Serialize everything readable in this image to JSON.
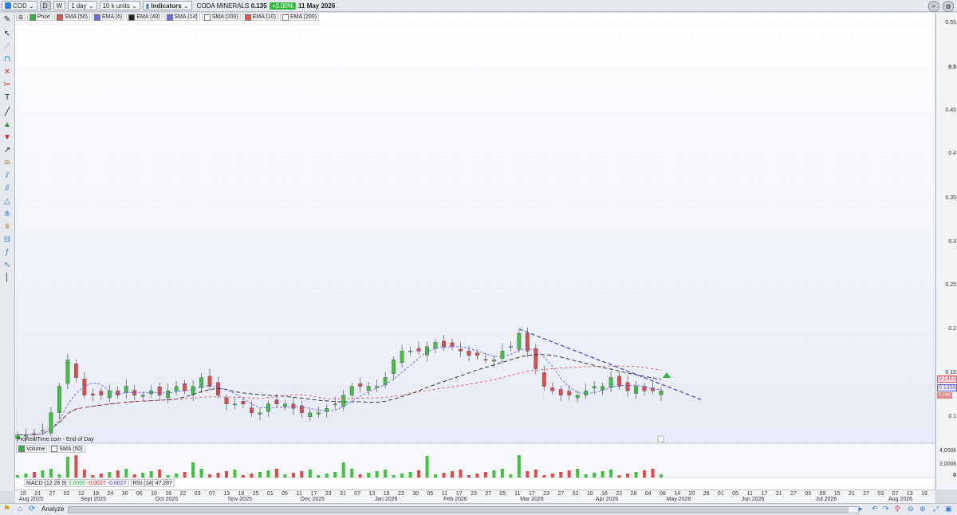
{
  "toolbar": {
    "symbol": "COD",
    "period_d": "D",
    "period_w": "W",
    "interval": "1 day",
    "units": "10 k units",
    "indicators_label": "Indicators",
    "instrument_name": "CODA MINERALS",
    "last_price": "0.135",
    "change": "+0.00%",
    "date": "11 May 2026"
  },
  "legend": {
    "price": "Price",
    "items": [
      {
        "label": "SMA (50)",
        "color": "#e05555"
      },
      {
        "label": "EMA (6)",
        "color": "#6a6ae8"
      },
      {
        "label": "EMA (43)",
        "color": "#222222"
      },
      {
        "label": "SMA (14)",
        "color": "#6a6ae8"
      },
      {
        "label": "SMA (200)",
        "color": "#ffffff"
      },
      {
        "label": "EMA (10)",
        "color": "#e05555"
      },
      {
        "label": "EMA (200)",
        "color": "#ffffff"
      }
    ]
  },
  "source_label": "ProRealTime.com - End of Day",
  "volume_panel": {
    "legend_volume": "Volume",
    "legend_sma": "SMA (50)",
    "axis": [
      "4,000k",
      "2,000k",
      "0"
    ]
  },
  "indicators_strip": {
    "macd_label": "MACD (12 26 9)",
    "macd_v1": "0.0000",
    "macd_v2": "-0.0027",
    "macd_v3": "-0.0027",
    "rsi_label": "RSI (14)",
    "rsi_value": "47.287"
  },
  "price_axis": {
    "labels": [
      "0.55",
      "0.5",
      "0.45",
      "0.4",
      "0.35",
      "0.3",
      "0.25",
      "0.2",
      "0.15",
      "0.1"
    ],
    "badges": [
      {
        "value": "0.1463",
        "color": "#e05555"
      },
      {
        "value": "0.1359",
        "color": "#5a5ae0"
      },
      {
        "value": "0.1350",
        "color": "#222222"
      }
    ]
  },
  "time_axis": {
    "days": [
      "15",
      "21",
      "27",
      "02",
      "12",
      "18",
      "24",
      "30",
      "06",
      "10",
      "16",
      "22",
      "03",
      "07",
      "13",
      "19",
      "25",
      "01",
      "05",
      "11",
      "17",
      "23",
      "31",
      "07",
      "13",
      "19",
      "23",
      "30",
      "05",
      "11",
      "17",
      "23",
      "27",
      "05",
      "11",
      "17",
      "23",
      "27",
      "02",
      "10",
      "16",
      "22",
      "28",
      "04",
      "08",
      "14",
      "20",
      "26",
      "01",
      "05",
      "11",
      "17",
      "21",
      "27",
      "03",
      "09",
      "15",
      "21",
      "27",
      "03",
      "07",
      "13",
      "19"
    ],
    "months": [
      "Aug 2025",
      "Sept 2025",
      "Oct 2025",
      "Nov 2025",
      "Dec 2025",
      "Jan 2026",
      "Feb 2026",
      "Mar 2026",
      "Apr 2026",
      "May 2026",
      "Jun 2026",
      "Jul 2026",
      "Aug 2026"
    ]
  },
  "bottom": {
    "analyze_label": "Analyze"
  },
  "chart_data": {
    "type": "candlestick",
    "title": "CODA MINERALS",
    "ylim": [
      0.08,
      0.56
    ],
    "y_ticks": [
      0.1,
      0.15,
      0.2,
      0.25,
      0.3,
      0.35,
      0.4,
      0.45,
      0.5,
      0.55
    ],
    "approx_close_series": [
      0.085,
      0.085,
      0.085,
      0.09,
      0.11,
      0.14,
      0.17,
      0.15,
      0.13,
      0.13,
      0.13,
      0.135,
      0.13,
      0.14,
      0.13,
      0.13,
      0.135,
      0.13,
      0.135,
      0.14,
      0.135,
      0.14,
      0.15,
      0.14,
      0.13,
      0.12,
      0.12,
      0.12,
      0.11,
      0.11,
      0.12,
      0.12,
      0.12,
      0.115,
      0.11,
      0.11,
      0.11,
      0.115,
      0.12,
      0.13,
      0.14,
      0.14,
      0.14,
      0.14,
      0.15,
      0.17,
      0.18,
      0.18,
      0.18,
      0.185,
      0.19,
      0.185,
      0.185,
      0.18,
      0.175,
      0.175,
      0.17,
      0.17,
      0.18,
      0.185,
      0.2,
      0.18,
      0.16,
      0.14,
      0.135,
      0.13,
      0.13,
      0.13,
      0.135,
      0.14,
      0.14,
      0.15,
      0.14,
      0.135,
      0.14,
      0.135,
      0.135,
      0.135
    ],
    "trendline": {
      "start": 0.205,
      "end": 0.125,
      "style": "dashed",
      "color": "#3a3ad8"
    }
  }
}
